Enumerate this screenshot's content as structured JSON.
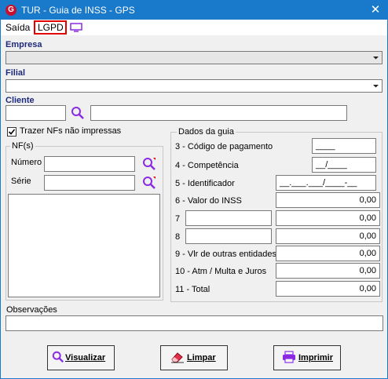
{
  "window": {
    "title": "TUR - Guia de INSS - GPS",
    "app_icon_letter": "G",
    "close_glyph": "✕"
  },
  "menu": {
    "exit_label": "Saída",
    "lgpd_label": "LGPD"
  },
  "empresa": {
    "label": "Empresa",
    "value": ""
  },
  "filial": {
    "label": "Filial",
    "value": ""
  },
  "cliente": {
    "label": "Cliente",
    "code": "",
    "name": ""
  },
  "trazer_nfs": {
    "label": "Trazer NFs não impressas",
    "checked": true
  },
  "nfs": {
    "group_title": "NF(s)",
    "numero_label": "Número",
    "numero_value": "",
    "serie_label": "Série",
    "serie_value": ""
  },
  "guia": {
    "group_title": "Dados da guia",
    "rows": {
      "codigo": {
        "label": "3 - Código de pagamento",
        "value": "____"
      },
      "competencia": {
        "label": "4 - Competência",
        "value": "__/____"
      },
      "identificador": {
        "label": "5 - Identificador",
        "value": "__.___.___/____-__"
      },
      "valor_inss": {
        "label": "6 - Valor do INSS",
        "value": "0,00"
      },
      "row7": {
        "label": "7",
        "desc": "",
        "value": "0,00"
      },
      "row8": {
        "label": "8",
        "desc": "",
        "value": "0,00"
      },
      "outras": {
        "label": "9 - Vlr de outras entidades",
        "value": "0,00"
      },
      "atm": {
        "label": "10 - Atm / Multa e Juros",
        "value": "0,00"
      },
      "total": {
        "label": "11 - Total",
        "value": "0,00"
      }
    }
  },
  "observacoes": {
    "label": "Observações",
    "value": ""
  },
  "buttons": {
    "visualizar": "Visualizar",
    "limpar": "Limpar",
    "imprimir": "Imprimir"
  },
  "icons": {
    "app": "app-logo-icon",
    "close": "close-icon",
    "monitor": "monitor-icon",
    "search": "search-icon",
    "print": "printer-icon",
    "eraser": "eraser-icon"
  },
  "colors": {
    "titlebar": "#1979ca",
    "section_label": "#1e2a7a",
    "lgpd_border": "#e00000",
    "search_icon": "#8a2be2"
  }
}
